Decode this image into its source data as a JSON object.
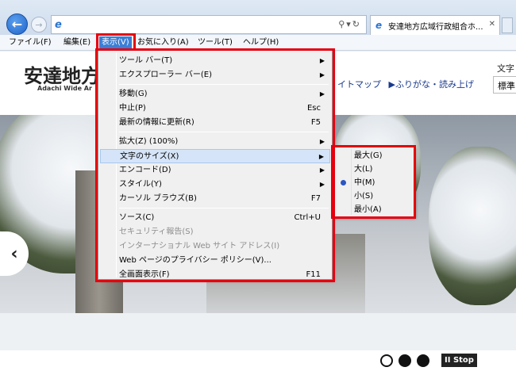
{
  "browser": {
    "address_value": "",
    "tab_title": "安達地方広域行政組合ホ...",
    "menubar": [
      {
        "label": "ファイル(F)"
      },
      {
        "label": "編集(E)"
      },
      {
        "label": "表示(V)"
      },
      {
        "label": "お気に入り(A)"
      },
      {
        "label": "ツール(T)"
      },
      {
        "label": "ヘルプ(H)"
      }
    ]
  },
  "site": {
    "title": "安達地方",
    "subtitle": "Adachi Wide Ar",
    "links": [
      "イトマップ",
      "▶ふりがな・読み上げ"
    ],
    "fontsize_label": "文字",
    "fontsize_value": "標準"
  },
  "view_menu": {
    "items": [
      {
        "label": "ツール バー(T)",
        "shortcut": "",
        "submenu": true
      },
      {
        "label": "エクスプローラー バー(E)",
        "shortcut": "",
        "submenu": true
      },
      {
        "label": "移動(G)",
        "shortcut": "",
        "submenu": true
      },
      {
        "label": "中止(P)",
        "shortcut": "Esc",
        "submenu": false
      },
      {
        "label": "最新の情報に更新(R)",
        "shortcut": "F5",
        "submenu": false
      },
      {
        "label": "拡大(Z) (100%)",
        "shortcut": "",
        "submenu": true
      },
      {
        "label": "文字のサイズ(X)",
        "shortcut": "",
        "submenu": true
      },
      {
        "label": "エンコード(D)",
        "shortcut": "",
        "submenu": true
      },
      {
        "label": "スタイル(Y)",
        "shortcut": "",
        "submenu": true
      },
      {
        "label": "カーソル ブラウズ(B)",
        "shortcut": "F7",
        "submenu": false
      },
      {
        "label": "ソース(C)",
        "shortcut": "Ctrl+U",
        "submenu": false
      },
      {
        "label": "セキュリティ報告(S)",
        "shortcut": "",
        "submenu": false
      },
      {
        "label": "インターナショナル Web サイト アドレス(I)",
        "shortcut": "",
        "submenu": false
      },
      {
        "label": "Web ページのプライバシー ポリシー(V)...",
        "shortcut": "",
        "submenu": false
      },
      {
        "label": "全画面表示(F)",
        "shortcut": "F11",
        "submenu": false
      }
    ]
  },
  "text_size_menu": {
    "items": [
      {
        "label": "最大(G)"
      },
      {
        "label": "大(L)"
      },
      {
        "label": "中(M)",
        "selected": true
      },
      {
        "label": "小(S)"
      },
      {
        "label": "最小(A)"
      }
    ]
  },
  "slider": {
    "stop_label": "Stop",
    "pause_glyph": "II"
  },
  "colors": {
    "highlight": "#e6000e",
    "menu_active": "#3b7ed6"
  }
}
